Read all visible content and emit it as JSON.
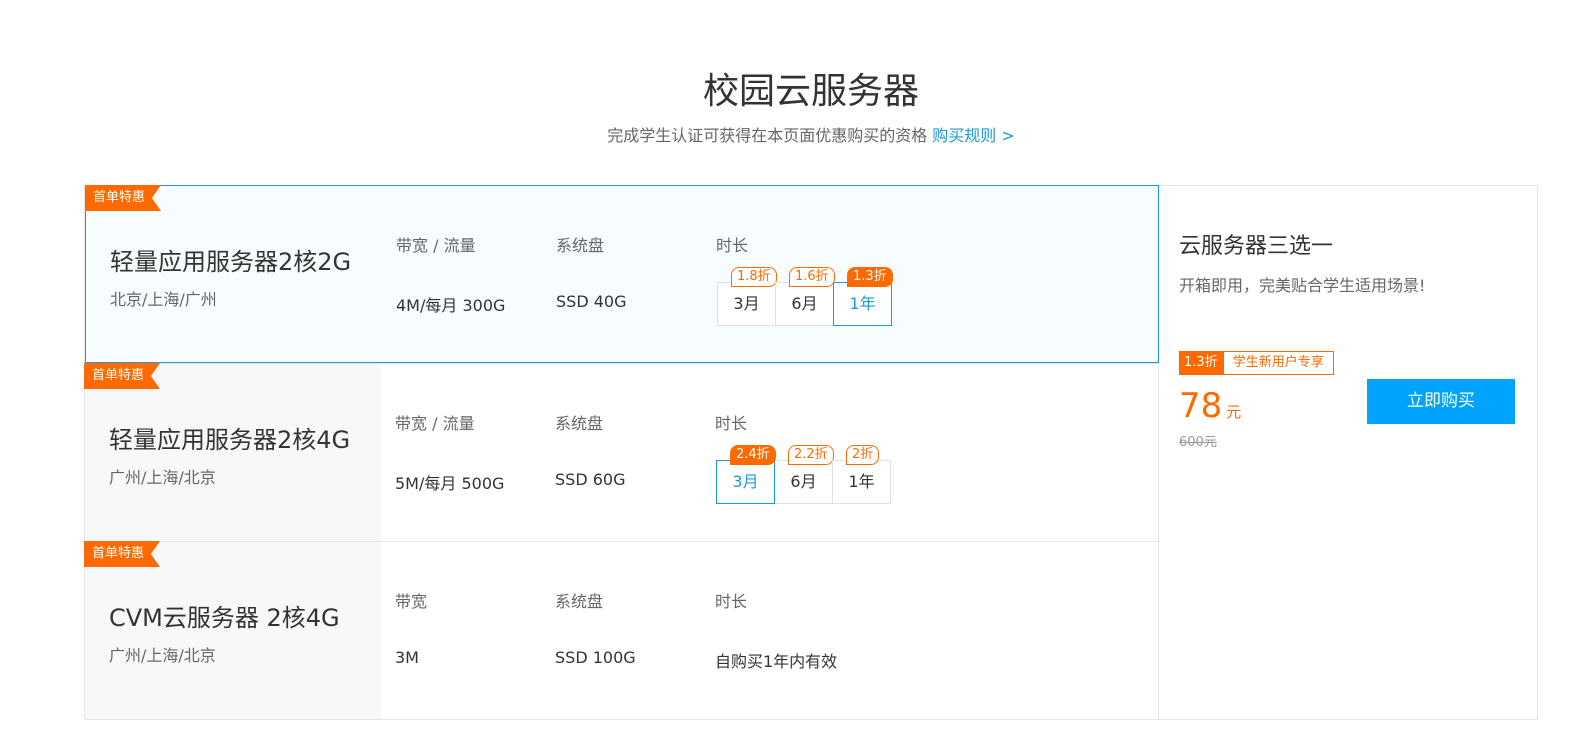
{
  "header": {
    "title": "校园云服务器",
    "subtitle": "完成学生认证可获得在本页面优惠购买的资格",
    "rules_link": "购买规则 >"
  },
  "plans": [
    {
      "badge": "首单特惠",
      "name": "轻量应用服务器2核2G",
      "regions": "北京/上海/广州",
      "bandwidth_label": "带宽 / 流量",
      "bandwidth_value": "4M/每月 300G",
      "disk_label": "系统盘",
      "disk_value": "SSD 40G",
      "duration_label": "时长",
      "durations": [
        {
          "label": "3月",
          "discount": "1.8折"
        },
        {
          "label": "6月",
          "discount": "1.6折"
        },
        {
          "label": "1年",
          "discount": "1.3折"
        }
      ],
      "selected": true
    },
    {
      "badge": "首单特惠",
      "name": "轻量应用服务器2核4G",
      "regions": "广州/上海/北京",
      "bandwidth_label": "带宽 / 流量",
      "bandwidth_value": "5M/每月 500G",
      "disk_label": "系统盘",
      "disk_value": "SSD 60G",
      "duration_label": "时长",
      "durations": [
        {
          "label": "3月",
          "discount": "2.4折"
        },
        {
          "label": "6月",
          "discount": "2.2折"
        },
        {
          "label": "1年",
          "discount": "2折"
        }
      ],
      "selected": false
    },
    {
      "badge": "首单特惠",
      "name": "CVM云服务器 2核4G",
      "regions": "广州/上海/北京",
      "bandwidth_label": "带宽",
      "bandwidth_value": "3M",
      "disk_label": "系统盘",
      "disk_value": "SSD 100G",
      "duration_label": "时长",
      "duration_text": "自购买1年内有效",
      "selected": false
    }
  ],
  "sidebar": {
    "title": "云服务器三选一",
    "description": "开箱即用，完美贴合学生适用场景!",
    "discount_tag": "1.3折",
    "user_tag": "学生新用户专享",
    "price": "78",
    "price_unit": "元",
    "original_price": "600元",
    "buy_label": "立即购买"
  },
  "colors": {
    "accent_orange": "#ff6a00",
    "accent_blue": "#1a9bd7",
    "button_blue": "#00a4ff"
  }
}
